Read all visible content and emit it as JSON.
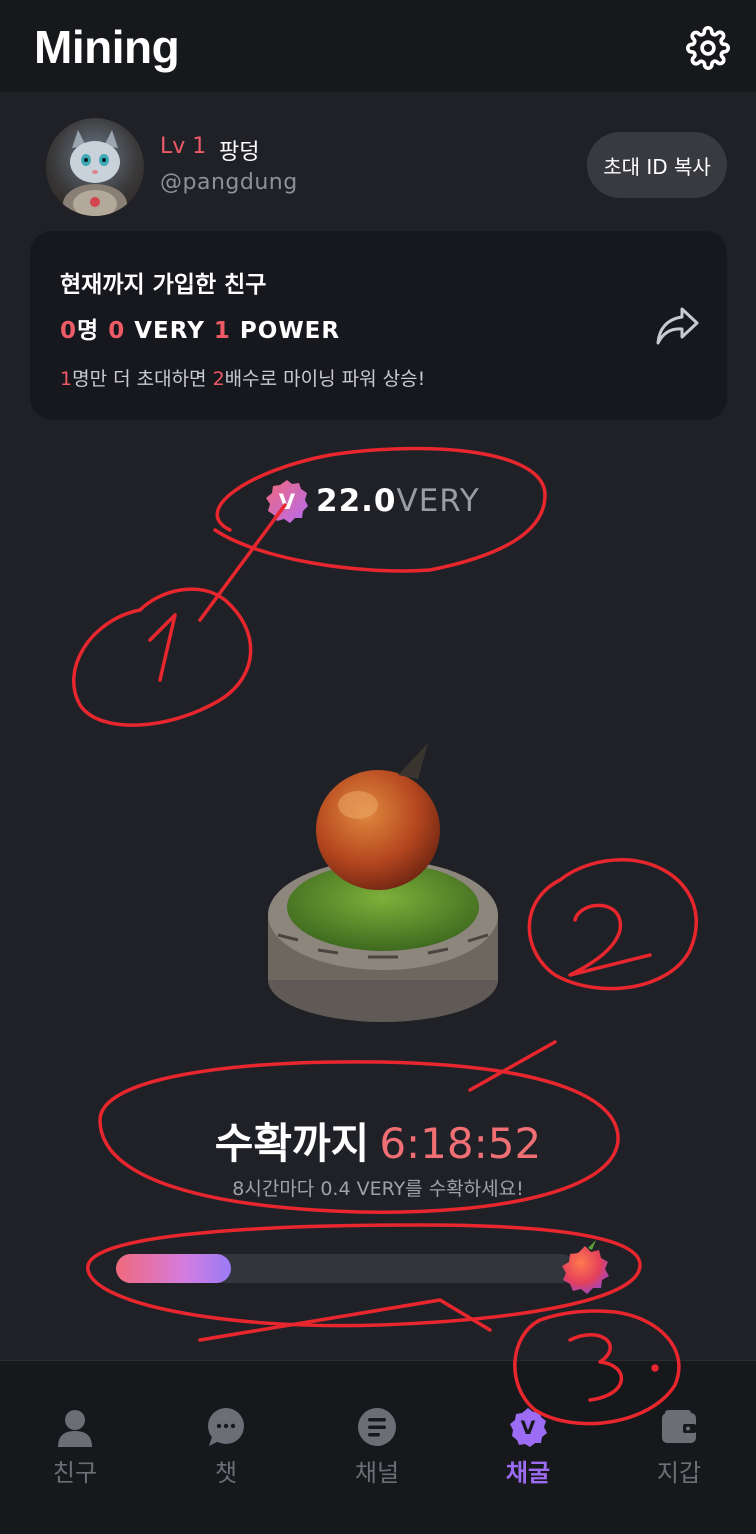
{
  "header": {
    "title": "Mining",
    "settings_icon": "gear-icon"
  },
  "profile": {
    "level": "Lv 1",
    "nickname": "팡덩",
    "handle": "@pangdung",
    "invite_button": "초대 ID 복사"
  },
  "friends_card": {
    "title": "현재까지 가입한 친구",
    "friends_count": "0",
    "friends_unit": "명",
    "very_count": "0",
    "very_unit": "VERY",
    "power_count": "1",
    "power_unit": "POWER",
    "invite_more_count": "1",
    "invite_more_text": "명만 더 초대하면 ",
    "multiplier": "2",
    "multiplier_text": "배수로 마이닝 파워 상승!",
    "share_icon": "share-arrow-icon"
  },
  "balance": {
    "badge_letter": "V",
    "amount": "22.0",
    "unit": "VERY"
  },
  "harvest": {
    "label": "수확까지",
    "timer": "6:18:52",
    "note": "8시간마다 0.4 VERY를 수확하세요!",
    "progress": 0.25
  },
  "annotations": [
    "1",
    "2",
    "3."
  ],
  "nav": {
    "items": [
      {
        "label": "친구",
        "icon": "person-icon",
        "active": false
      },
      {
        "label": "챗",
        "icon": "chat-bubble-icon",
        "active": false
      },
      {
        "label": "채널",
        "icon": "channel-icon",
        "active": false
      },
      {
        "label": "채굴",
        "icon": "very-badge-icon",
        "active": true
      },
      {
        "label": "지갑",
        "icon": "wallet-icon",
        "active": false
      }
    ]
  },
  "colors": {
    "accent_red": "#ef5a67",
    "active_purple": "#9c6cf5",
    "background": "#202127",
    "annotation": "#e8262e"
  }
}
